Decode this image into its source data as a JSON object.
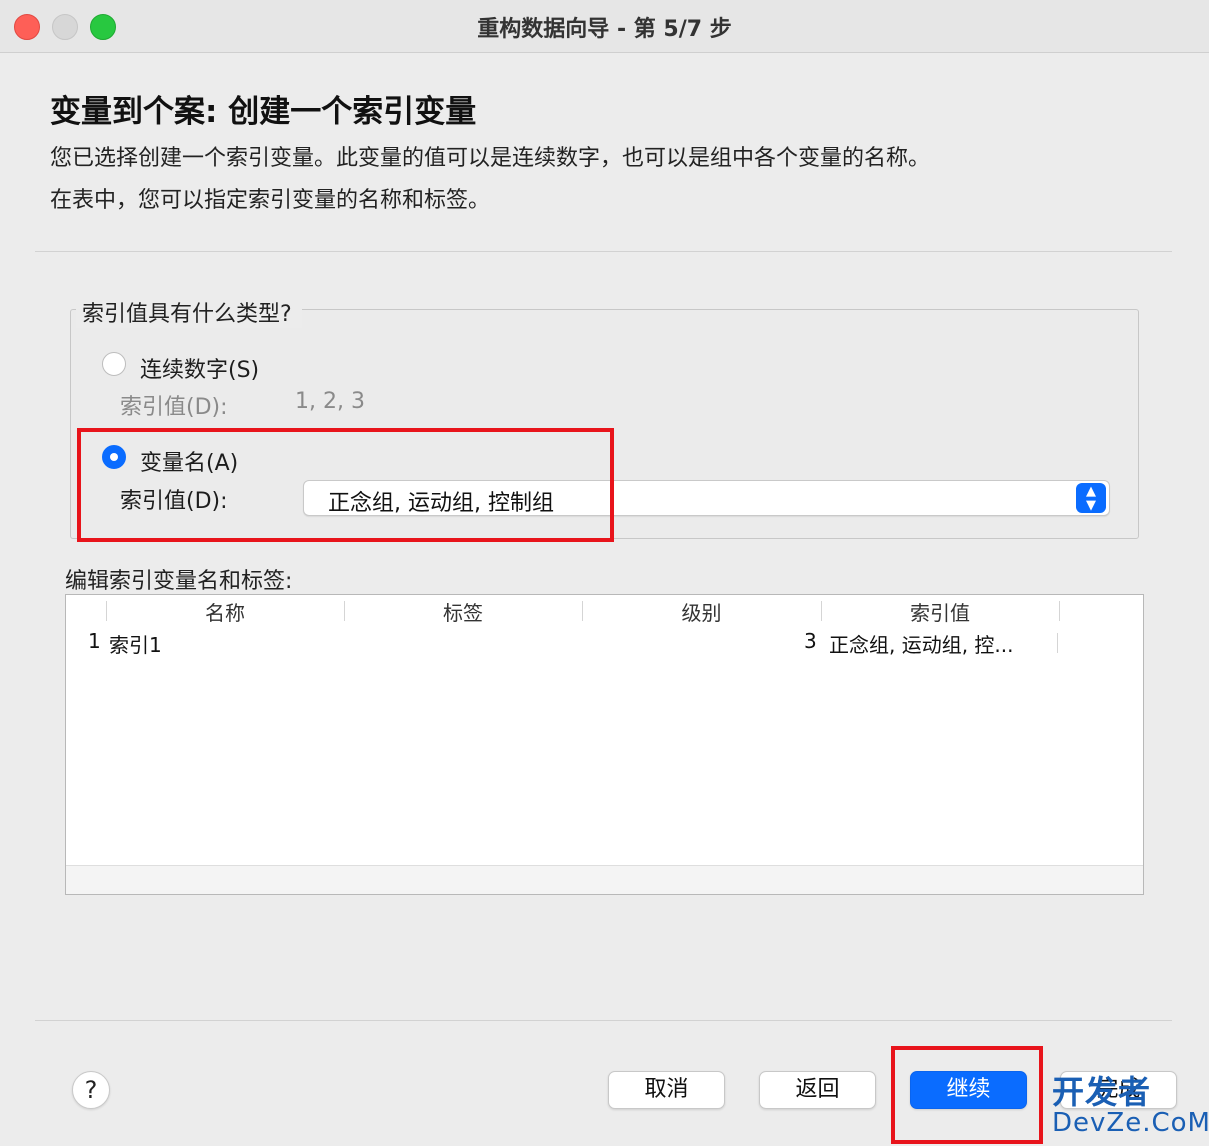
{
  "window": {
    "title": "重构数据向导 - 第 5/7 步"
  },
  "header": {
    "title": "变量到个案: 创建一个索引变量",
    "description_line1": "您已选择创建一个索引变量。此变量的值可以是连续数字，也可以是组中各个变量的名称。",
    "description_line2": "在表中，您可以指定索引变量的名称和标签。"
  },
  "index_type": {
    "legend": "索引值具有什么类型?",
    "options": [
      {
        "label": "连续数字(S)",
        "checked": false,
        "index_label": "索引值(D):",
        "index_value": "1, 2, 3"
      },
      {
        "label": "变量名(A)",
        "checked": true,
        "index_label": "索引值(D):",
        "index_value": "正念组, 运动组, 控制组"
      }
    ]
  },
  "table": {
    "title": "编辑索引变量名和标签:",
    "columns": [
      "名称",
      "标签",
      "级别",
      "索引值"
    ],
    "rows": [
      {
        "row_number": "1",
        "name": "索引1",
        "label": "",
        "level": "3",
        "index_values": "正念组, 运动组, 控..."
      }
    ]
  },
  "buttons": {
    "help": "?",
    "cancel": "取消",
    "back": "返回",
    "continue": "继续",
    "finish": "完成"
  },
  "watermark": {
    "line1": "开发者",
    "line2": "DevZe.CoM"
  },
  "colors": {
    "accent": "#0a6cff",
    "highlight": "#e8141b"
  }
}
